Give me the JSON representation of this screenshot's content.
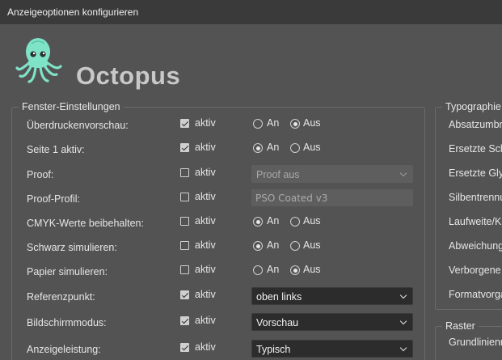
{
  "window": {
    "title": "Anzeigeoptionen konfigurieren"
  },
  "app": {
    "name": "Octopus",
    "logo_icon": "octopus-icon",
    "logo_color": "#7fe3c8"
  },
  "fenster": {
    "legend": "Fenster-Einstellungen",
    "rows": [
      {
        "label": "Überdruckenvorschau:",
        "checkbox_label": "aktiv",
        "checked": true,
        "control": "radio",
        "options": [
          "An",
          "Aus"
        ],
        "selected": "Aus"
      },
      {
        "label": "Seite 1 aktiv:",
        "checkbox_label": "aktiv",
        "checked": true,
        "control": "radio",
        "options": [
          "An",
          "Aus"
        ],
        "selected": "An"
      },
      {
        "label": "Proof:",
        "checkbox_label": "aktiv",
        "checked": false,
        "control": "select",
        "value": "Proof aus",
        "disabled": true
      },
      {
        "label": "Proof-Profil:",
        "checkbox_label": "aktiv",
        "checked": false,
        "control": "text",
        "value": "PSO Coated v3"
      },
      {
        "label": "CMYK-Werte beibehalten:",
        "checkbox_label": "aktiv",
        "checked": false,
        "control": "radio",
        "options": [
          "An",
          "Aus"
        ],
        "selected": "An"
      },
      {
        "label": "Schwarz simulieren:",
        "checkbox_label": "aktiv",
        "checked": false,
        "control": "radio",
        "options": [
          "An",
          "Aus"
        ],
        "selected": "An"
      },
      {
        "label": "Papier simulieren:",
        "checkbox_label": "aktiv",
        "checked": false,
        "control": "radio",
        "options": [
          "An",
          "Aus"
        ],
        "selected": "Aus"
      },
      {
        "label": "Referenzpunkt:",
        "checkbox_label": "aktiv",
        "checked": true,
        "control": "select",
        "value": "oben links",
        "disabled": false
      },
      {
        "label": "Bildschirmmodus:",
        "checkbox_label": "aktiv",
        "checked": true,
        "control": "select",
        "value": "Vorschau",
        "disabled": false
      },
      {
        "label": "Anzeigeleistung:",
        "checkbox_label": "aktiv",
        "checked": true,
        "control": "select",
        "value": "Typisch",
        "disabled": false
      }
    ]
  },
  "typographie": {
    "legend": "Typographie",
    "items": [
      "Absatzumbr",
      "Ersetzte Sch",
      "Ersetzte Gly",
      "Silbentrennu",
      "Laufweite/K",
      "Abweichung",
      "Verborgene",
      "Formatvorga"
    ]
  },
  "raster": {
    "legend": "Raster",
    "items": [
      "Grundlinienr"
    ]
  }
}
